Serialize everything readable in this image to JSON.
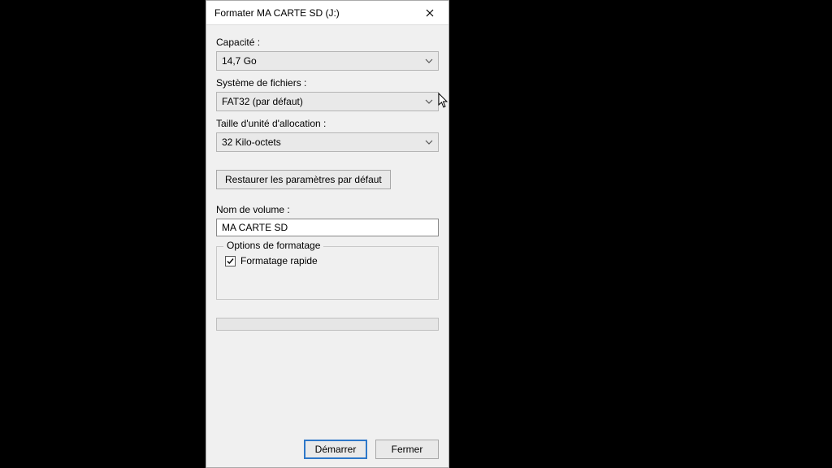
{
  "dialog": {
    "title": "Formater MA CARTE SD (J:)",
    "capacity_label": "Capacité :",
    "capacity_value": "14,7 Go",
    "filesystem_label": "Système de fichiers :",
    "filesystem_value": "FAT32 (par défaut)",
    "allocation_label": "Taille d'unité d'allocation :",
    "allocation_value": "32 Kilo-octets",
    "restore_defaults": "Restaurer les paramètres par défaut",
    "volume_label": "Nom de volume :",
    "volume_value": "MA CARTE SD",
    "format_options_legend": "Options de formatage",
    "quick_format_label": "Formatage rapide",
    "start_button": "Démarrer",
    "close_button": "Fermer"
  }
}
